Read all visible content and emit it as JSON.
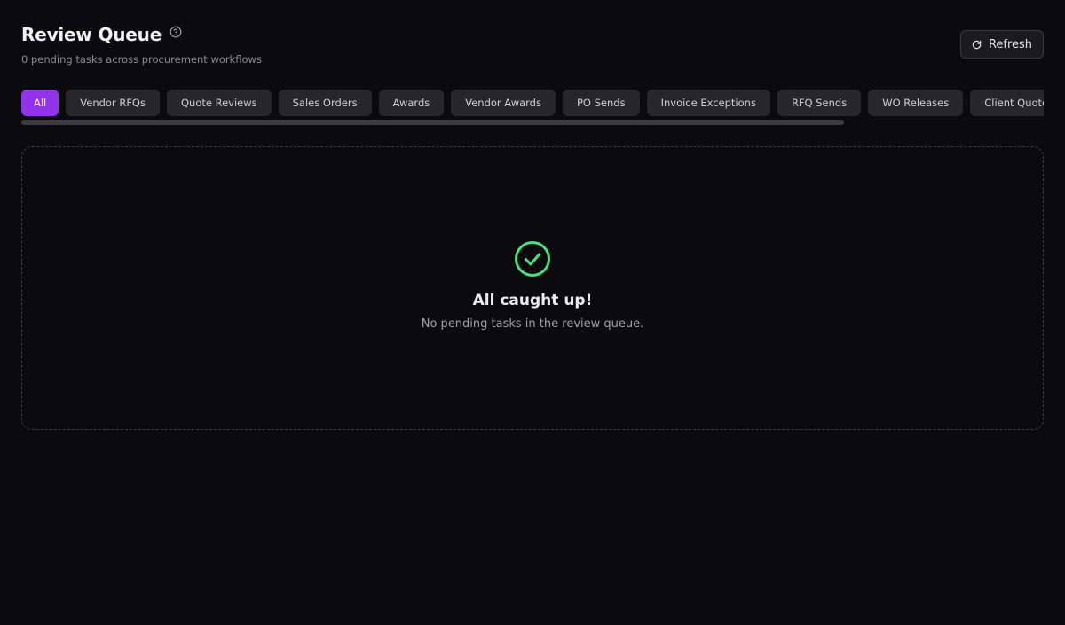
{
  "header": {
    "title": "Review Queue",
    "subtitle": "0 pending tasks across procurement workflows",
    "help_icon": "help-circle-icon",
    "refresh_label": "Refresh",
    "refresh_icon": "refresh-icon"
  },
  "tabs": [
    {
      "label": "All",
      "active": true
    },
    {
      "label": "Vendor RFQs",
      "active": false
    },
    {
      "label": "Quote Reviews",
      "active": false
    },
    {
      "label": "Sales Orders",
      "active": false
    },
    {
      "label": "Awards",
      "active": false
    },
    {
      "label": "Vendor Awards",
      "active": false
    },
    {
      "label": "PO Sends",
      "active": false
    },
    {
      "label": "Invoice Exceptions",
      "active": false
    },
    {
      "label": "RFQ Sends",
      "active": false
    },
    {
      "label": "WO Releases",
      "active": false
    },
    {
      "label": "Client Quotes",
      "active": false
    }
  ],
  "empty_state": {
    "icon": "check-circle-icon",
    "title": "All caught up!",
    "message": "No pending tasks in the review queue."
  },
  "colors": {
    "background": "#0b0b0d",
    "accent": "#9333ea",
    "success": "#4ade80"
  }
}
